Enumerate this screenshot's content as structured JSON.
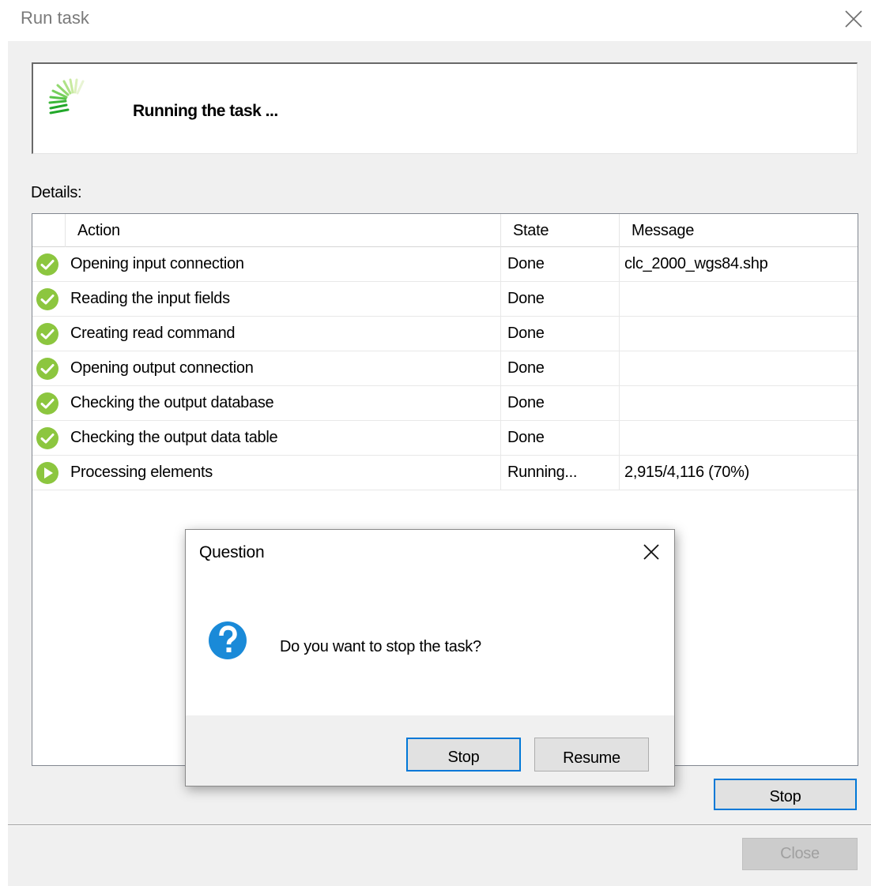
{
  "window": {
    "title": "Run task",
    "banner_message": "Running the task ...",
    "details_label": "Details:"
  },
  "grid": {
    "columns": [
      "Action",
      "State",
      "Message"
    ],
    "rows": [
      {
        "status_icon": "check-circle-icon",
        "action": "Opening input connection",
        "state": "Done",
        "message": "clc_2000_wgs84.shp"
      },
      {
        "status_icon": "check-circle-icon",
        "action": "Reading the input fields",
        "state": "Done",
        "message": ""
      },
      {
        "status_icon": "check-circle-icon",
        "action": "Creating read command",
        "state": "Done",
        "message": ""
      },
      {
        "status_icon": "check-circle-icon",
        "action": "Opening output connection",
        "state": "Done",
        "message": ""
      },
      {
        "status_icon": "check-circle-icon",
        "action": "Checking the output database",
        "state": "Done",
        "message": ""
      },
      {
        "status_icon": "check-circle-icon",
        "action": "Checking the output data table",
        "state": "Done",
        "message": ""
      },
      {
        "status_icon": "play-circle-icon",
        "action": "Processing elements",
        "state": "Running...",
        "message": "2,915/4,116 (70%)"
      }
    ]
  },
  "buttons": {
    "stop": "Stop",
    "close": "Close"
  },
  "dialog": {
    "title": "Question",
    "question": "Do you want to stop the task?",
    "stop_label": "Stop",
    "resume_label": "Resume"
  },
  "colors": {
    "accent": "#0078d7",
    "success_green": "#8cc63f",
    "spinner_green": "#3fbf2f",
    "question_blue": "#1a8ad8"
  }
}
